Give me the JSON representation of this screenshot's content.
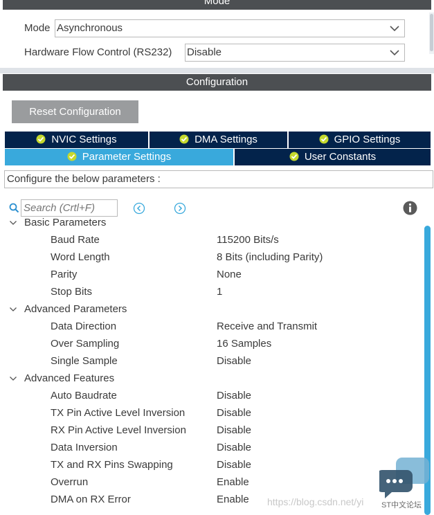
{
  "mode_section": {
    "header": "Mode",
    "mode_label": "Mode",
    "mode_value": "Asynchronous",
    "flow_label": "Hardware Flow Control (RS232)",
    "flow_value": "Disable"
  },
  "config_section": {
    "header": "Configuration",
    "reset_button": "Reset Configuration",
    "tabs": [
      {
        "label": "NVIC Settings",
        "active": false
      },
      {
        "label": "DMA Settings",
        "active": false
      },
      {
        "label": "GPIO Settings",
        "active": false
      },
      {
        "label": "Parameter Settings",
        "active": true
      },
      {
        "label": "User Constants",
        "active": false
      }
    ],
    "description": "Configure the below parameters :",
    "search_placeholder": "Search (Crtl+F)"
  },
  "tree": [
    {
      "type": "group",
      "label": "Basic Parameters"
    },
    {
      "type": "param",
      "label": "Baud Rate",
      "value": "115200 Bits/s"
    },
    {
      "type": "param",
      "label": "Word Length",
      "value": "8 Bits (including Parity)"
    },
    {
      "type": "param",
      "label": "Parity",
      "value": "None"
    },
    {
      "type": "param",
      "label": "Stop Bits",
      "value": "1"
    },
    {
      "type": "group",
      "label": "Advanced Parameters"
    },
    {
      "type": "param",
      "label": "Data Direction",
      "value": "Receive and Transmit"
    },
    {
      "type": "param",
      "label": "Over Sampling",
      "value": "16 Samples"
    },
    {
      "type": "param",
      "label": "Single Sample",
      "value": "Disable"
    },
    {
      "type": "group",
      "label": "Advanced Features"
    },
    {
      "type": "param",
      "label": "Auto Baudrate",
      "value": "Disable"
    },
    {
      "type": "param",
      "label": "TX Pin Active Level Inversion",
      "value": "Disable"
    },
    {
      "type": "param",
      "label": "RX Pin Active Level Inversion",
      "value": "Disable"
    },
    {
      "type": "param",
      "label": "Data Inversion",
      "value": "Disable"
    },
    {
      "type": "param",
      "label": "TX and RX Pins Swapping",
      "value": "Disable"
    },
    {
      "type": "param",
      "label": "Overrun",
      "value": "Enable"
    },
    {
      "type": "param",
      "label": "DMA on RX Error",
      "value": "Enable"
    }
  ],
  "overlay": {
    "watermark": "https://blog.csdn.net/yi",
    "brand": "ST中文论坛"
  },
  "colors": {
    "header_bg": "#4c4f52",
    "tab_dark": "#03234b",
    "tab_active": "#39a9dc",
    "check_green": "#c5d92d",
    "button_gray": "#9a9c9e",
    "scroll_blue": "#39a9dc"
  },
  "icons": {
    "tab_check": "check-circle-icon",
    "dropdown": "chevron-down-icon",
    "search": "search-icon",
    "nav_prev": "arrow-left-circle-icon",
    "nav_next": "arrow-right-circle-icon",
    "info": "info-icon",
    "tree_caret": "chevron-down-icon",
    "chat": "chat-bubble-icon"
  }
}
